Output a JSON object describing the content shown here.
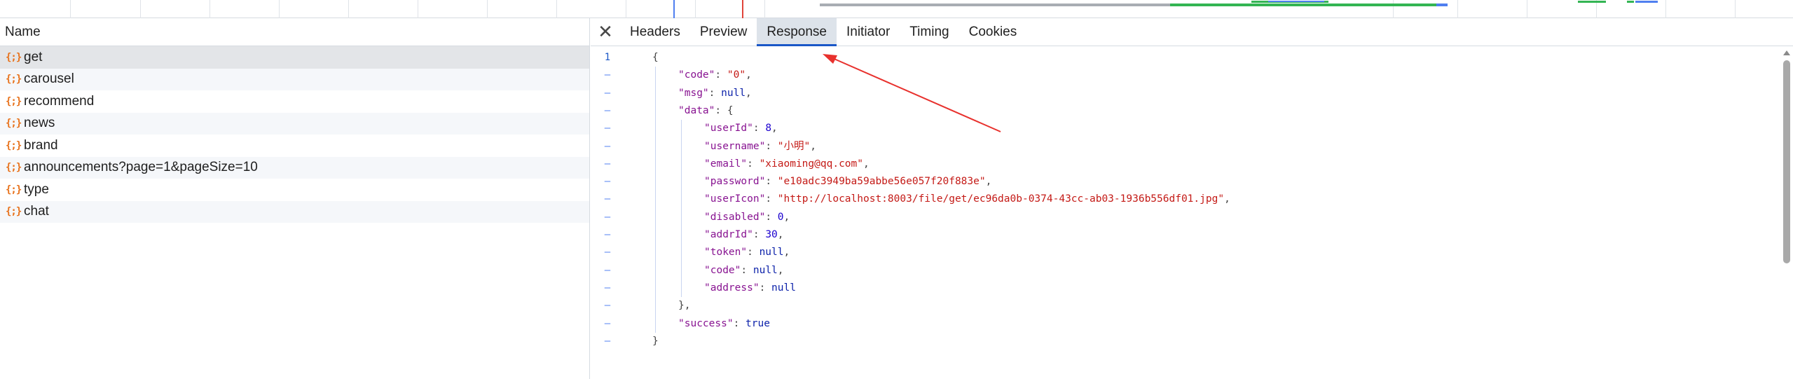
{
  "request_list": {
    "header": "Name",
    "icon": "json-brace-icon",
    "icon_glyph": "{;}",
    "items": [
      {
        "name": "get"
      },
      {
        "name": "carousel"
      },
      {
        "name": "recommend"
      },
      {
        "name": "news"
      },
      {
        "name": "brand"
      },
      {
        "name": "announcements?page=1&pageSize=10"
      },
      {
        "name": "type"
      },
      {
        "name": "chat"
      }
    ],
    "selected_index": 0
  },
  "detail": {
    "close_icon": "close-icon",
    "close_glyph": "✕",
    "tabs": [
      {
        "label": "Headers"
      },
      {
        "label": "Preview"
      },
      {
        "label": "Response"
      },
      {
        "label": "Initiator"
      },
      {
        "label": "Timing"
      },
      {
        "label": "Cookies"
      }
    ],
    "active_tab": "Response"
  },
  "response": {
    "gutter_first": "1",
    "gutter_fold": "–",
    "lines": [
      {
        "indent": 0,
        "tokens": [
          [
            "punc",
            "{"
          ]
        ]
      },
      {
        "indent": 1,
        "tokens": [
          [
            "key",
            "\"code\""
          ],
          [
            "punc",
            ": "
          ],
          [
            "str",
            "\"0\""
          ],
          [
            "punc",
            ","
          ]
        ]
      },
      {
        "indent": 1,
        "tokens": [
          [
            "key",
            "\"msg\""
          ],
          [
            "punc",
            ": "
          ],
          [
            "lit",
            "null"
          ],
          [
            "punc",
            ","
          ]
        ]
      },
      {
        "indent": 1,
        "tokens": [
          [
            "key",
            "\"data\""
          ],
          [
            "punc",
            ": {"
          ]
        ]
      },
      {
        "indent": 2,
        "tokens": [
          [
            "key",
            "\"userId\""
          ],
          [
            "punc",
            ": "
          ],
          [
            "num",
            "8"
          ],
          [
            "punc",
            ","
          ]
        ]
      },
      {
        "indent": 2,
        "tokens": [
          [
            "key",
            "\"username\""
          ],
          [
            "punc",
            ": "
          ],
          [
            "str",
            "\"小明\""
          ],
          [
            "punc",
            ","
          ]
        ]
      },
      {
        "indent": 2,
        "tokens": [
          [
            "key",
            "\"email\""
          ],
          [
            "punc",
            ": "
          ],
          [
            "str",
            "\"xiaoming@qq.com\""
          ],
          [
            "punc",
            ","
          ]
        ]
      },
      {
        "indent": 2,
        "tokens": [
          [
            "key",
            "\"password\""
          ],
          [
            "punc",
            ": "
          ],
          [
            "str",
            "\"e10adc3949ba59abbe56e057f20f883e\""
          ],
          [
            "punc",
            ","
          ]
        ]
      },
      {
        "indent": 2,
        "tokens": [
          [
            "key",
            "\"userIcon\""
          ],
          [
            "punc",
            ": "
          ],
          [
            "str",
            "\"http://localhost:8003/file/get/ec96da0b-0374-43cc-ab03-1936b556df01.jpg\""
          ],
          [
            "punc",
            ","
          ]
        ]
      },
      {
        "indent": 2,
        "tokens": [
          [
            "key",
            "\"disabled\""
          ],
          [
            "punc",
            ": "
          ],
          [
            "num",
            "0"
          ],
          [
            "punc",
            ","
          ]
        ]
      },
      {
        "indent": 2,
        "tokens": [
          [
            "key",
            "\"addrId\""
          ],
          [
            "punc",
            ": "
          ],
          [
            "num",
            "30"
          ],
          [
            "punc",
            ","
          ]
        ]
      },
      {
        "indent": 2,
        "tokens": [
          [
            "key",
            "\"token\""
          ],
          [
            "punc",
            ": "
          ],
          [
            "lit",
            "null"
          ],
          [
            "punc",
            ","
          ]
        ]
      },
      {
        "indent": 2,
        "tokens": [
          [
            "key",
            "\"code\""
          ],
          [
            "punc",
            ": "
          ],
          [
            "lit",
            "null"
          ],
          [
            "punc",
            ","
          ]
        ]
      },
      {
        "indent": 2,
        "tokens": [
          [
            "key",
            "\"address\""
          ],
          [
            "punc",
            ": "
          ],
          [
            "lit",
            "null"
          ]
        ]
      },
      {
        "indent": 1,
        "tokens": [
          [
            "punc",
            "},"
          ]
        ]
      },
      {
        "indent": 1,
        "tokens": [
          [
            "key",
            "\"success\""
          ],
          [
            "punc",
            ": "
          ],
          [
            "lit",
            "true"
          ]
        ]
      },
      {
        "indent": 0,
        "tokens": [
          [
            "punc",
            "}"
          ]
        ]
      }
    ]
  },
  "colors": {
    "accent": "#1a57c7",
    "json_icon": "#e8711a",
    "annotation_arrow": "#e8312d"
  }
}
